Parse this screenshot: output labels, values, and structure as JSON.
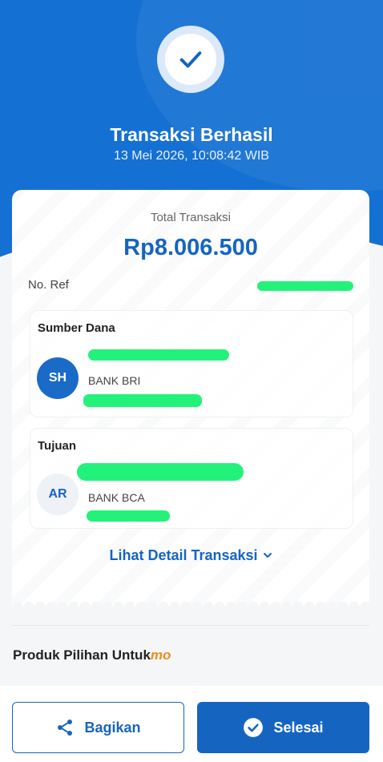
{
  "header": {
    "title": "Transaksi Berhasil",
    "datetime": "13 Mei 2026, 10:08:42 WIB"
  },
  "receipt": {
    "total_label": "Total Transaksi",
    "total_value": "Rp8.006.500",
    "ref_label": "No. Ref"
  },
  "source": {
    "title": "Sumber Dana",
    "initials": "SH",
    "bank": "BANK BRI"
  },
  "destination": {
    "title": "Tujuan",
    "initials": "AR",
    "bank": "BANK BCA"
  },
  "detail_link": "Lihat Detail Transaksi",
  "products": {
    "label": "Produk Pilihan Untuk",
    "brand": "mo"
  },
  "actions": {
    "share_label": "Bagikan",
    "done_label": "Selesai"
  },
  "colors": {
    "primary": "#1565c0",
    "hero_bg": "#1570d3",
    "redaction": "#22f27a",
    "brand_accent": "#f28c1b"
  },
  "icons": [
    "check-icon",
    "chevron-down-icon",
    "share-icon",
    "check-circle-icon"
  ]
}
